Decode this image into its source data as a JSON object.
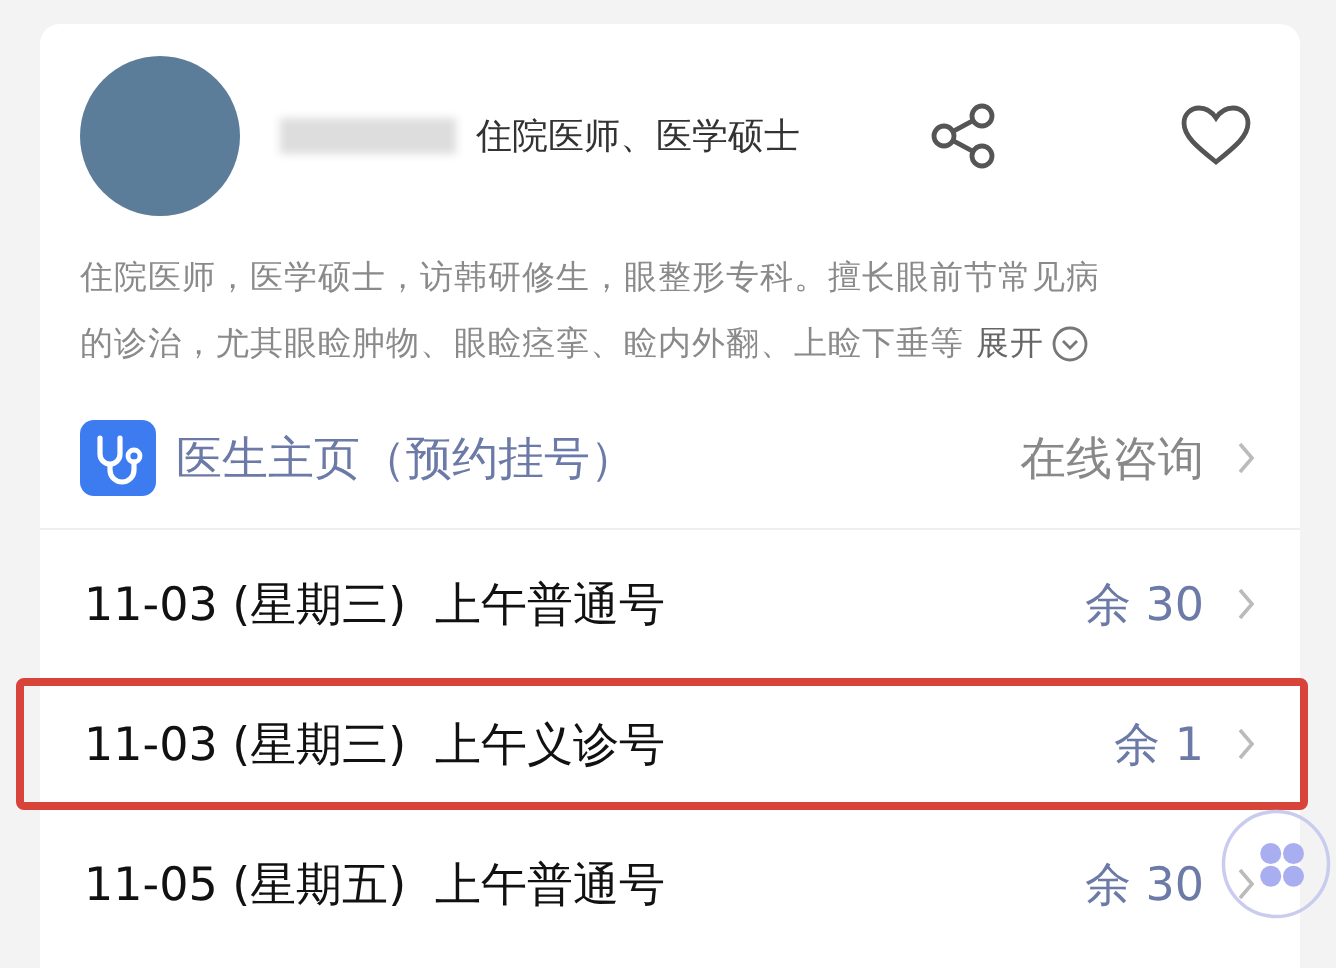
{
  "doctor": {
    "title": "住院医师、医学硕士",
    "description_lines": [
      "住院医师，医学硕士，访韩研修生，眼整形专科。擅长眼前节常见病",
      "的诊治，尤其眼睑肿物、眼睑痉挛、睑内外翻、上睑下垂等"
    ],
    "expand": "展开"
  },
  "homepage": {
    "label": "医生主页（预约挂号）",
    "consult": "在线咨询"
  },
  "slots": [
    {
      "date": "11-03 (星期三)",
      "type": "上午普通号",
      "remaining": "余 30",
      "highlighted": false
    },
    {
      "date": "11-03 (星期三)",
      "type": "上午义诊号",
      "remaining": "余 1",
      "highlighted": true
    },
    {
      "date": "11-05 (星期五)",
      "type": "上午普通号",
      "remaining": "余 30",
      "highlighted": false
    }
  ]
}
